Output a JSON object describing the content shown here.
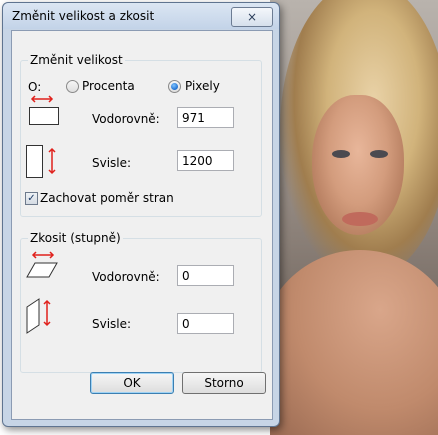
{
  "dialog": {
    "title": "Změnit velikost a zkosit",
    "close_glyph": "×"
  },
  "resize": {
    "group_label": "Změnit velikost",
    "by_label": "O:",
    "options": [
      {
        "label": "Procenta",
        "selected": false
      },
      {
        "label": "Pixely",
        "selected": true
      }
    ],
    "horizontal_label": "Vodorovně:",
    "horizontal_value": "971",
    "vertical_label": "Svisle:",
    "vertical_value": "1200",
    "keep_aspect_label": "Zachovat poměr stran",
    "keep_aspect_checked": true
  },
  "skew": {
    "group_label": "Zkosit (stupně)",
    "horizontal_label": "Vodorovně:",
    "horizontal_value": "0",
    "vertical_label": "Svisle:",
    "vertical_value": "0"
  },
  "buttons": {
    "ok_label": "OK",
    "cancel_label": "Storno"
  },
  "colors": {
    "arrow": "#e0201b",
    "window_frame": "#c7d5e6"
  }
}
